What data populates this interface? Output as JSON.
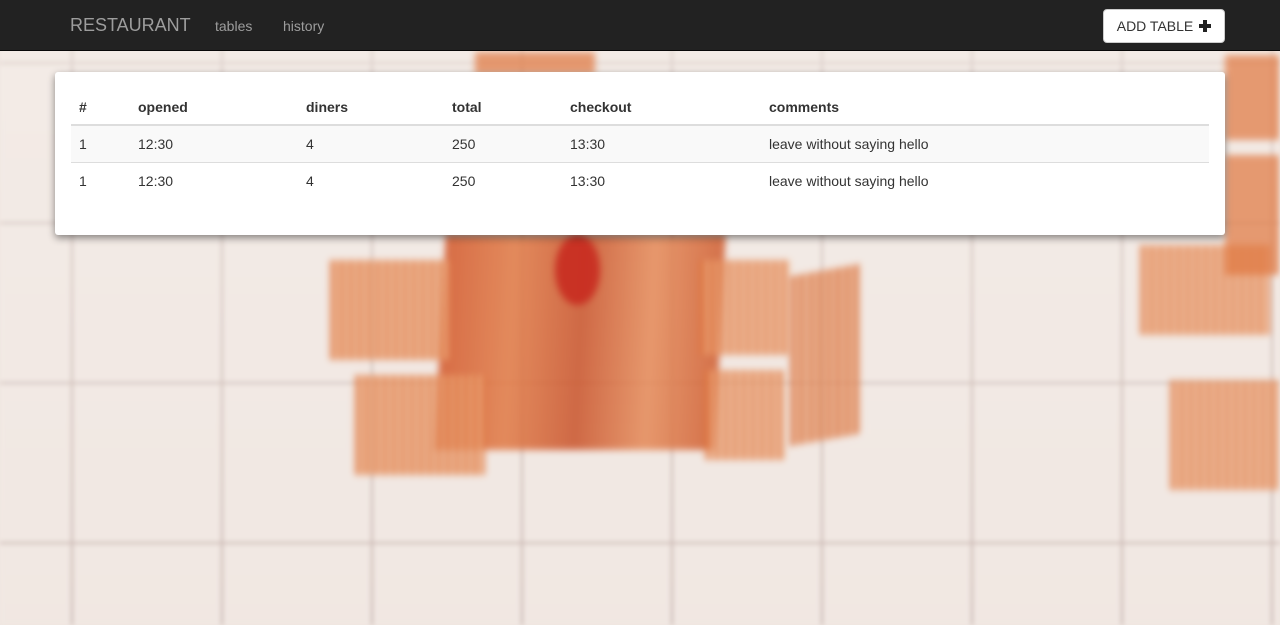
{
  "navbar": {
    "brand": "RESTAURANT",
    "links": [
      "tables",
      "history"
    ],
    "add_button": {
      "label": "ADD TABLE",
      "icon": "plus-icon"
    }
  },
  "table": {
    "headers": [
      "#",
      "opened",
      "diners",
      "total",
      "checkout",
      "comments"
    ],
    "rows": [
      [
        "1",
        "12:30",
        "4",
        "250",
        "13:30",
        "leave without saying hello"
      ],
      [
        "1",
        "12:30",
        "4",
        "250",
        "13:30",
        "leave without saying hello"
      ]
    ]
  },
  "colors": {
    "navbar": "#222222",
    "nav_text": "#9d9d9d",
    "panel": "#ffffff",
    "wood": "#d9662f"
  }
}
